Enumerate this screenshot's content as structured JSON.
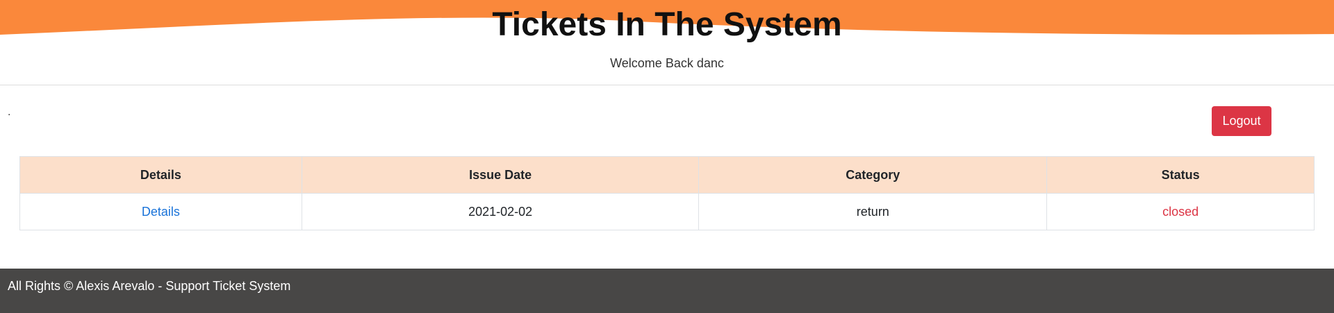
{
  "header": {
    "title": "Tickets In The System",
    "welcome": "Welcome Back danc",
    "wave_color": "#fa883b"
  },
  "toolbar": {
    "dot": ".",
    "logout_label": "Logout"
  },
  "table": {
    "columns": [
      "Details",
      "Issue Date",
      "Category",
      "Status"
    ],
    "rows": [
      {
        "details": "Details",
        "issue_date": "2021-02-02",
        "category": "return",
        "status": "closed"
      }
    ]
  },
  "footer": {
    "text": "All Rights © Alexis Arevalo - Support Ticket System"
  },
  "colors": {
    "accent": "#fa883b",
    "table_header_bg": "#fcdfca",
    "danger": "#dc3545",
    "link": "#1a73d9",
    "footer_bg": "#484746"
  }
}
